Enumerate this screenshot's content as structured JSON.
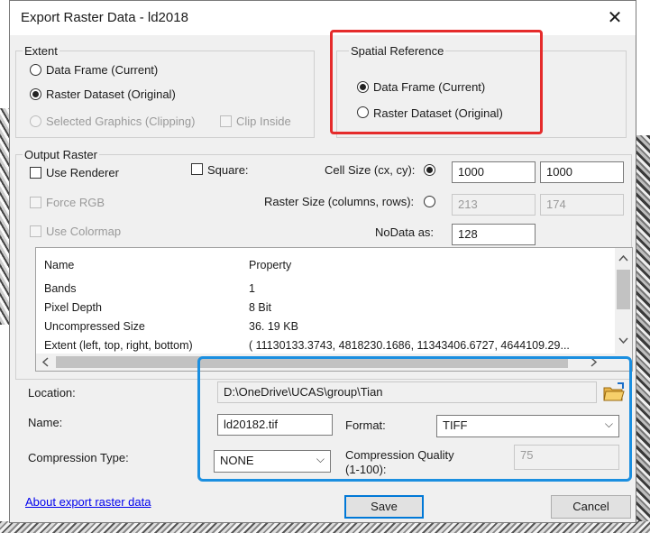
{
  "window": {
    "title": "Export Raster Data - ld2018",
    "close_glyph": "✕"
  },
  "extent": {
    "legend": "Extent",
    "opt_data_frame": "Data Frame (Current)",
    "opt_raster_dataset": "Raster Dataset (Original)",
    "opt_selected_graphics": "Selected Graphics (Clipping)",
    "clip_inside": "Clip Inside"
  },
  "spatial_reference": {
    "legend": "Spatial Reference",
    "opt_data_frame": "Data Frame (Current)",
    "opt_raster_dataset": "Raster Dataset (Original)"
  },
  "output_raster": {
    "legend": "Output Raster",
    "use_renderer": "Use Renderer",
    "square": "Square:",
    "force_rgb": "Force RGB",
    "use_colormap": "Use Colormap",
    "cell_size_label": "Cell Size (cx, cy):",
    "cell_size_x": "1000",
    "cell_size_y": "1000",
    "raster_size_label": "Raster Size (columns, rows):",
    "raster_cols": "213",
    "raster_rows": "174",
    "nodata_label": "NoData as:",
    "nodata_value": "128"
  },
  "properties": {
    "header_name": "Name",
    "header_property": "Property",
    "rows": [
      {
        "name": "Bands",
        "value": "1"
      },
      {
        "name": "Pixel Depth",
        "value": "8 Bit"
      },
      {
        "name": "Uncompressed Size",
        "value": "36. 19 KB"
      },
      {
        "name": "Extent (left, top, right, bottom)",
        "value": "( 11130133.3743, 4818230.1686, 11343406.6727, 4644109.29..."
      }
    ]
  },
  "output": {
    "location_label": "Location:",
    "location_value": "D:\\OneDrive\\UCAS\\group\\Tian",
    "name_label": "Name:",
    "name_value": "ld20182.tif",
    "format_label": "Format:",
    "format_value": "TIFF",
    "compression_type_label": "Compression Type:",
    "compression_type_value": "NONE",
    "compression_quality_label_1": "Compression Quality",
    "compression_quality_label_2": "(1-100):",
    "compression_quality_value": "75"
  },
  "footer": {
    "about_link": "About export raster data",
    "save": "Save",
    "cancel": "Cancel"
  },
  "colors": {
    "highlight_red": "#e52b2b",
    "highlight_blue": "#1b8fe0",
    "accent": "#0078d7"
  }
}
